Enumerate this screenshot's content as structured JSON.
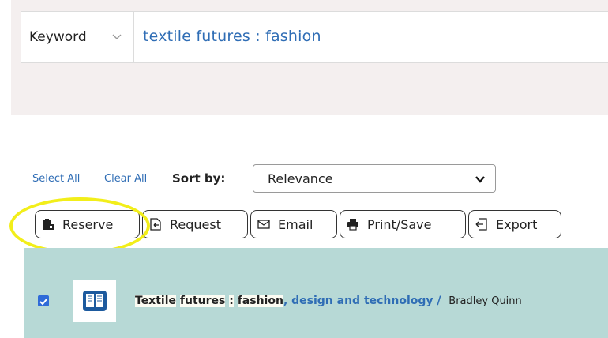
{
  "search": {
    "scope": "Keyword",
    "query": "textile futures : fashion"
  },
  "toolbar": {
    "select_all": "Select All",
    "clear_all": "Clear All",
    "sort_label": "Sort by:",
    "sort_value": "Relevance"
  },
  "actions": {
    "reserve": "Reserve",
    "request": "Request",
    "email": "Email",
    "print_save": "Print/Save",
    "export": "Export"
  },
  "result": {
    "checked": true,
    "title_part1": "Textile",
    "title_part2": "futures",
    "title_part3": ":",
    "title_part4": "fashion",
    "title_rest": ", design and technology /",
    "author": "Bradley Quinn"
  },
  "colors": {
    "accent_link": "#2f6db5",
    "result_row_bg": "#b7d9d6",
    "highlight_ring": "#f2ee1a"
  }
}
